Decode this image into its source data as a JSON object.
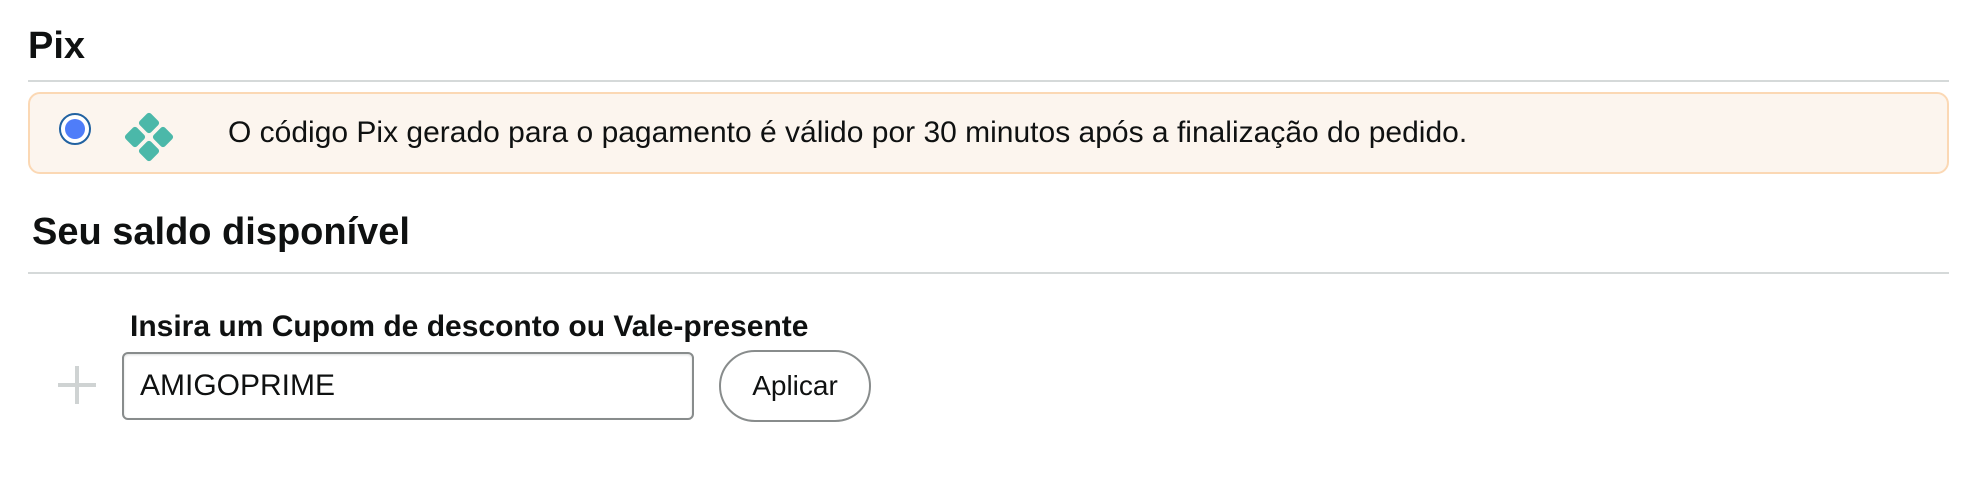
{
  "pix_section": {
    "title": "Pix",
    "option": {
      "selected": true,
      "icon": "pix-icon",
      "description": "O código Pix gerado para o pagamento é válido por 30 minutos após a finalização do pedido."
    }
  },
  "balance_section": {
    "title": "Seu saldo disponível",
    "coupon": {
      "label": "Insira um Cupom de desconto ou Vale-presente",
      "value": "AMIGOPRIME",
      "apply_label": "Aplicar",
      "expand_icon": "plus-icon"
    }
  },
  "colors": {
    "radio_selected": "#4f7df9",
    "pix_icon": "#4bb8a9",
    "option_background": "#fcf5ee",
    "option_border": "#fbd8b4"
  }
}
